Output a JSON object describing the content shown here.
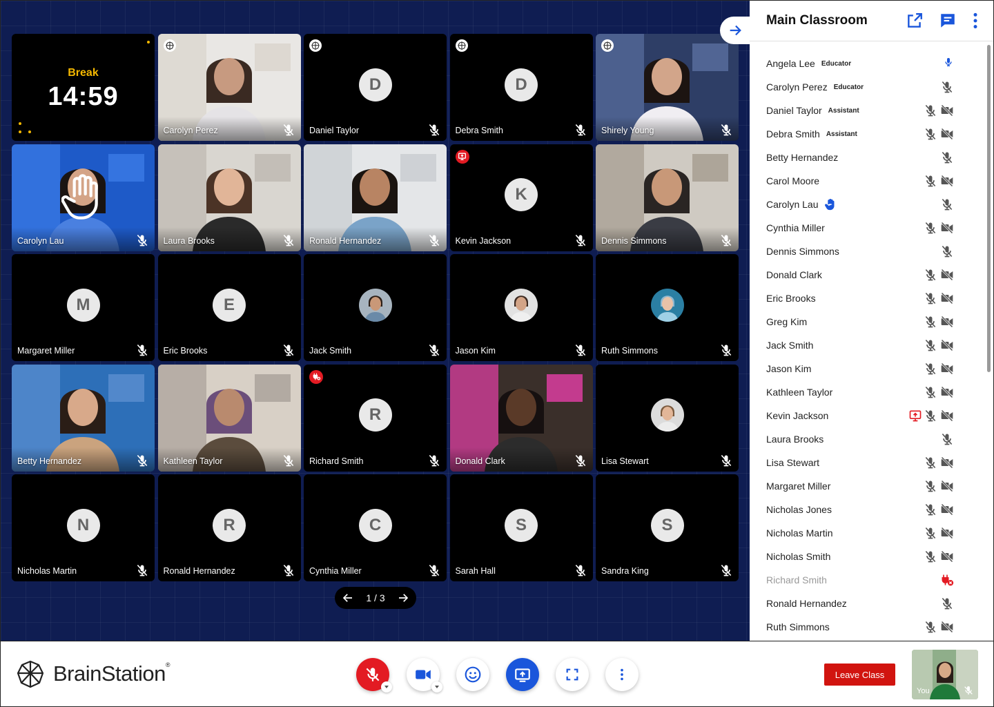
{
  "colors": {
    "stage_bg": "#0f1d52",
    "accent_blue": "#1a56db",
    "danger_red": "#d1140f",
    "break_yellow": "#f5b800"
  },
  "timer": {
    "label": "Break",
    "time": "14:59"
  },
  "tiles": [
    {
      "name": "Carolyn Perez",
      "kind": "photo",
      "badge": "brain"
    },
    {
      "name": "Daniel Taylor",
      "kind": "initial",
      "initial": "D",
      "badge": "brain"
    },
    {
      "name": "Debra Smith",
      "kind": "initial",
      "initial": "D",
      "badge": "brain"
    },
    {
      "name": "Shirely Young",
      "kind": "photo",
      "badge": "brain"
    },
    {
      "name": "Carolyn Lau",
      "kind": "photo",
      "hand_raised": true
    },
    {
      "name": "Laura Brooks",
      "kind": "photo"
    },
    {
      "name": "Ronald Hernandez",
      "kind": "photo"
    },
    {
      "name": "Kevin Jackson",
      "kind": "initial",
      "initial": "K",
      "badge": "screen-share"
    },
    {
      "name": "Dennis Simmons",
      "kind": "photo"
    },
    {
      "name": "Margaret Miller",
      "kind": "initial",
      "initial": "M"
    },
    {
      "name": "Eric Brooks",
      "kind": "initial",
      "initial": "E"
    },
    {
      "name": "Jack Smith",
      "kind": "avatar"
    },
    {
      "name": "Jason Kim",
      "kind": "avatar"
    },
    {
      "name": "Ruth Simmons",
      "kind": "avatar"
    },
    {
      "name": "Betty Hernandez",
      "kind": "photo"
    },
    {
      "name": "Kathleen Taylor",
      "kind": "photo"
    },
    {
      "name": "Richard Smith",
      "kind": "initial",
      "initial": "R",
      "badge": "disconnected"
    },
    {
      "name": "Donald Clark",
      "kind": "photo"
    },
    {
      "name": "Lisa Stewart",
      "kind": "avatar"
    },
    {
      "name": "Nicholas Martin",
      "kind": "initial",
      "initial": "N"
    },
    {
      "name": "Ronald Hernandez",
      "kind": "initial",
      "initial": "R"
    },
    {
      "name": "Cynthia Miller",
      "kind": "initial",
      "initial": "C"
    },
    {
      "name": "Sarah Hall",
      "kind": "initial",
      "initial": "S"
    },
    {
      "name": "Sandra King",
      "kind": "initial",
      "initial": "S"
    }
  ],
  "pager": {
    "label": "1 / 3"
  },
  "panel": {
    "title": "Main Classroom",
    "participants": [
      {
        "name": "Angela Lee",
        "role": "Educator",
        "icons": [
          "mic-active"
        ]
      },
      {
        "name": "Carolyn Perez",
        "role": "Educator",
        "icons": [
          "mic-off"
        ]
      },
      {
        "name": "Daniel Taylor",
        "role": "Assistant",
        "icons": [
          "mic-off",
          "cam-off"
        ]
      },
      {
        "name": "Debra Smith",
        "role": "Assistant",
        "icons": [
          "mic-off",
          "cam-off"
        ]
      },
      {
        "name": "Betty Hernandez",
        "role": "",
        "icons": [
          "mic-off"
        ]
      },
      {
        "name": "Carol Moore",
        "role": "",
        "icons": [
          "mic-off",
          "cam-off"
        ]
      },
      {
        "name": "Carolyn Lau",
        "role": "",
        "hand": true,
        "icons": [
          "mic-off"
        ]
      },
      {
        "name": "Cynthia Miller",
        "role": "",
        "icons": [
          "mic-off",
          "cam-off"
        ]
      },
      {
        "name": "Dennis Simmons",
        "role": "",
        "icons": [
          "mic-off"
        ]
      },
      {
        "name": "Donald Clark",
        "role": "",
        "icons": [
          "mic-off",
          "cam-off"
        ]
      },
      {
        "name": "Eric Brooks",
        "role": "",
        "icons": [
          "mic-off",
          "cam-off"
        ]
      },
      {
        "name": "Greg Kim",
        "role": "",
        "icons": [
          "mic-off",
          "cam-off"
        ]
      },
      {
        "name": "Jack Smith",
        "role": "",
        "icons": [
          "mic-off",
          "cam-off"
        ]
      },
      {
        "name": "Jason Kim",
        "role": "",
        "icons": [
          "mic-off",
          "cam-off"
        ]
      },
      {
        "name": "Kathleen Taylor",
        "role": "",
        "icons": [
          "mic-off",
          "cam-off"
        ]
      },
      {
        "name": "Kevin Jackson",
        "role": "",
        "icons": [
          "screen-share",
          "mic-off",
          "cam-off"
        ]
      },
      {
        "name": "Laura Brooks",
        "role": "",
        "icons": [
          "mic-off"
        ]
      },
      {
        "name": "Lisa Stewart",
        "role": "",
        "icons": [
          "mic-off",
          "cam-off"
        ]
      },
      {
        "name": "Margaret Miller",
        "role": "",
        "icons": [
          "mic-off",
          "cam-off"
        ]
      },
      {
        "name": "Nicholas Jones",
        "role": "",
        "icons": [
          "mic-off",
          "cam-off"
        ]
      },
      {
        "name": "Nicholas Martin",
        "role": "",
        "icons": [
          "mic-off",
          "cam-off"
        ]
      },
      {
        "name": "Nicholas Smith",
        "role": "",
        "icons": [
          "mic-off",
          "cam-off"
        ]
      },
      {
        "name": "Richard Smith",
        "role": "",
        "dim": true,
        "icons": [
          "disconnected"
        ]
      },
      {
        "name": "Ronald Hernandez",
        "role": "",
        "icons": [
          "mic-off"
        ]
      },
      {
        "name": "Ruth Simmons",
        "role": "",
        "icons": [
          "mic-off",
          "cam-off"
        ]
      }
    ]
  },
  "bottombar": {
    "brand": "BrainStation",
    "brand_mark": "®",
    "leave_label": "Leave Class",
    "self_label": "You"
  }
}
